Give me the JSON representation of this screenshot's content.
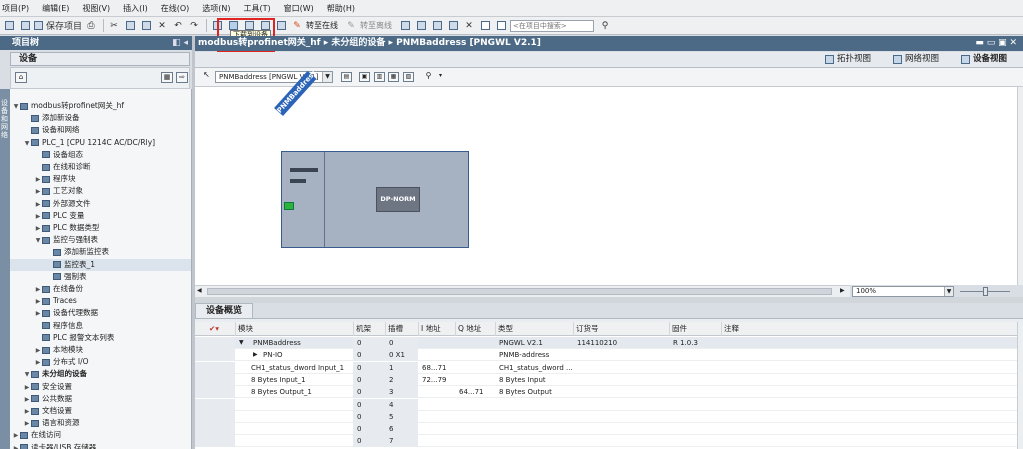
{
  "menu": [
    "项目(P)",
    "编辑(E)",
    "视图(V)",
    "插入(I)",
    "在线(O)",
    "选项(N)",
    "工具(T)",
    "窗口(W)",
    "帮助(H)"
  ],
  "toolbar": {
    "save_project": "保存项目",
    "go_online": "转至在线",
    "go_offline": "转至离线",
    "search_placeholder": "<在项目中搜索>",
    "tooltip": "下载到设备"
  },
  "left_panel": {
    "title": "项目树",
    "tab": "设备",
    "side_label": "设备和网络",
    "tree": [
      {
        "label": "modbus转profinet网关_hf",
        "level": 0,
        "arrow": "▼"
      },
      {
        "label": "添加新设备",
        "level": 1,
        "arrow": ""
      },
      {
        "label": "设备和网络",
        "level": 1,
        "arrow": ""
      },
      {
        "label": "PLC_1 [CPU 1214C AC/DC/Rly]",
        "level": 1,
        "arrow": "▼"
      },
      {
        "label": "设备组态",
        "level": 2,
        "arrow": ""
      },
      {
        "label": "在线和诊断",
        "level": 2,
        "arrow": ""
      },
      {
        "label": "程序块",
        "level": 2,
        "arrow": "▶"
      },
      {
        "label": "工艺对象",
        "level": 2,
        "arrow": "▶"
      },
      {
        "label": "外部源文件",
        "level": 2,
        "arrow": "▶"
      },
      {
        "label": "PLC 变量",
        "level": 2,
        "arrow": "▶"
      },
      {
        "label": "PLC 数据类型",
        "level": 2,
        "arrow": "▶"
      },
      {
        "label": "监控与强制表",
        "level": 2,
        "arrow": "▼"
      },
      {
        "label": "添加新监控表",
        "level": 3,
        "arrow": ""
      },
      {
        "label": "监控表_1",
        "level": 3,
        "arrow": "",
        "selected": true
      },
      {
        "label": "强制表",
        "level": 3,
        "arrow": ""
      },
      {
        "label": "在线备份",
        "level": 2,
        "arrow": "▶"
      },
      {
        "label": "Traces",
        "level": 2,
        "arrow": "▶"
      },
      {
        "label": "设备代理数据",
        "level": 2,
        "arrow": "▶"
      },
      {
        "label": "程序信息",
        "level": 2,
        "arrow": ""
      },
      {
        "label": "PLC 报警文本列表",
        "level": 2,
        "arrow": ""
      },
      {
        "label": "本地模块",
        "level": 2,
        "arrow": "▶"
      },
      {
        "label": "分布式 I/O",
        "level": 2,
        "arrow": "▶"
      },
      {
        "label": "未分组的设备",
        "level": 1,
        "arrow": "▼",
        "bold": true
      },
      {
        "label": "安全设置",
        "level": 1,
        "arrow": "▶"
      },
      {
        "label": "公共数据",
        "level": 1,
        "arrow": "▶"
      },
      {
        "label": "文档设置",
        "level": 1,
        "arrow": "▶"
      },
      {
        "label": "语言和资源",
        "level": 1,
        "arrow": "▶"
      },
      {
        "label": "在线访问",
        "level": 0,
        "arrow": "▶"
      },
      {
        "label": "读卡器/USB 存储器",
        "level": 0,
        "arrow": "▶"
      }
    ]
  },
  "breadcrumb": "modbus转profinet网关_hf  ▸  未分组的设备  ▸  PNMBaddress [PNGWL V2.1]",
  "view_tabs": {
    "topology": "拓扑视图",
    "network": "网络视图",
    "device": "设备视图"
  },
  "device_select": "PNMBaddress [PNGWL V2.1]",
  "module_label": "PNMBaddress",
  "module_inner": "DP-NORM",
  "zoom": "100%",
  "overview": {
    "tab": "设备概览",
    "columns": [
      "模块",
      "机架",
      "插槽",
      "I 地址",
      "Q 地址",
      "类型",
      "订货号",
      "固件",
      "注释"
    ],
    "rows": [
      {
        "module": "PNMBaddress",
        "arrow": "▼",
        "rack": "0",
        "slot": "0",
        "i": "",
        "q": "",
        "type": "PNGWL V2.1",
        "order": "114110210",
        "fw": "R 1.0.3"
      },
      {
        "module": "PN-IO",
        "arrow": "▶",
        "rack": "0",
        "slot": "0 X1",
        "i": "",
        "q": "",
        "type": "PNMB-address",
        "order": "",
        "fw": ""
      },
      {
        "module": "CH1_status_dword Input_1",
        "arrow": "",
        "rack": "0",
        "slot": "1",
        "i": "68...71",
        "q": "",
        "type": "CH1_status_dword ...",
        "order": "",
        "fw": ""
      },
      {
        "module": "8 Bytes Input_1",
        "arrow": "",
        "rack": "0",
        "slot": "2",
        "i": "72...79",
        "q": "",
        "type": "8 Bytes Input",
        "order": "",
        "fw": ""
      },
      {
        "module": "8 Bytes Output_1",
        "arrow": "",
        "rack": "0",
        "slot": "3",
        "i": "",
        "q": "64...71",
        "type": "8 Bytes Output",
        "order": "",
        "fw": ""
      },
      {
        "module": "",
        "arrow": "",
        "rack": "0",
        "slot": "4",
        "i": "",
        "q": "",
        "type": "",
        "order": "",
        "fw": ""
      },
      {
        "module": "",
        "arrow": "",
        "rack": "0",
        "slot": "5",
        "i": "",
        "q": "",
        "type": "",
        "order": "",
        "fw": ""
      },
      {
        "module": "",
        "arrow": "",
        "rack": "0",
        "slot": "6",
        "i": "",
        "q": "",
        "type": "",
        "order": "",
        "fw": ""
      },
      {
        "module": "",
        "arrow": "",
        "rack": "0",
        "slot": "7",
        "i": "",
        "q": "",
        "type": "",
        "order": "",
        "fw": ""
      }
    ]
  },
  "colors": {
    "header_bg": "#4c6a86",
    "highlight_border": "#e02424",
    "module_label_bg": "#2a63b8",
    "status_led": "#2bb33a"
  }
}
